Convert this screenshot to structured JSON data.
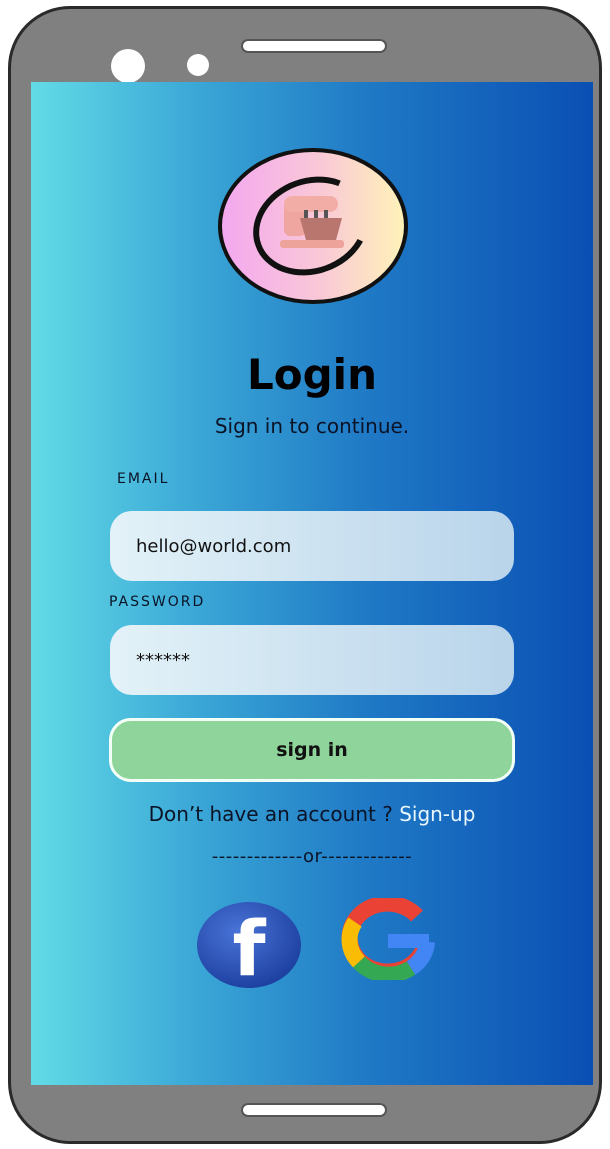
{
  "login": {
    "title": "Login",
    "subtitle": "Sign in to continue.",
    "email_label": "EMAIL",
    "email_value": "hello@world.com",
    "password_label": "PASSWORD",
    "password_value": "******",
    "signin_label": "sign in",
    "account_prompt": "Don’t have an account ?",
    "signup_link": "Sign-up",
    "divider_text": "-------------or-------------",
    "social": {
      "facebook_letter": "f",
      "facebook_icon": "facebook-icon",
      "google_icon": "google-icon"
    },
    "colors": {
      "button": "#8fd49a",
      "gradient_start": "#62dbe6",
      "gradient_end": "#0a4fb3",
      "link": "#e8f7ff"
    }
  }
}
